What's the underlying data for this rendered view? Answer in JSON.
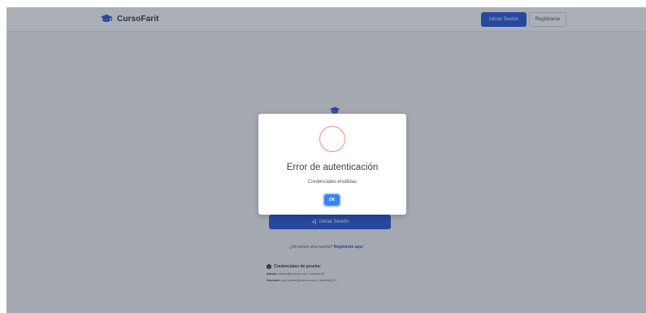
{
  "navbar": {
    "brand": "CursoFarit",
    "login_label": "Iniciar Sesión",
    "register_label": "Registrarse"
  },
  "background": {
    "submit_label": "Iniciar Sesión",
    "signup_prompt": "¿No tienes una cuenta?",
    "signup_link": "Regístrate aquí",
    "credentials_title": "Credenciales de prueba:",
    "admin_label": "Admin:",
    "admin_value": "admin@cursos.com / admin123",
    "teacher_label": "Docente:",
    "teacher_value": "juan.perez@cursos.com / docente123"
  },
  "modal": {
    "title": "Error de autenticación",
    "message": "Credenciales inválidas",
    "ok_label": "OK"
  },
  "colors": {
    "primary": "#1d4ed8",
    "ok_button": "#3b82f6",
    "error_ring": "#f28b82"
  },
  "icons": {
    "brand": "graduation-cap-icon",
    "submit": "sign-in-icon",
    "info": "info-circle-icon",
    "error": "error-circle-icon"
  }
}
